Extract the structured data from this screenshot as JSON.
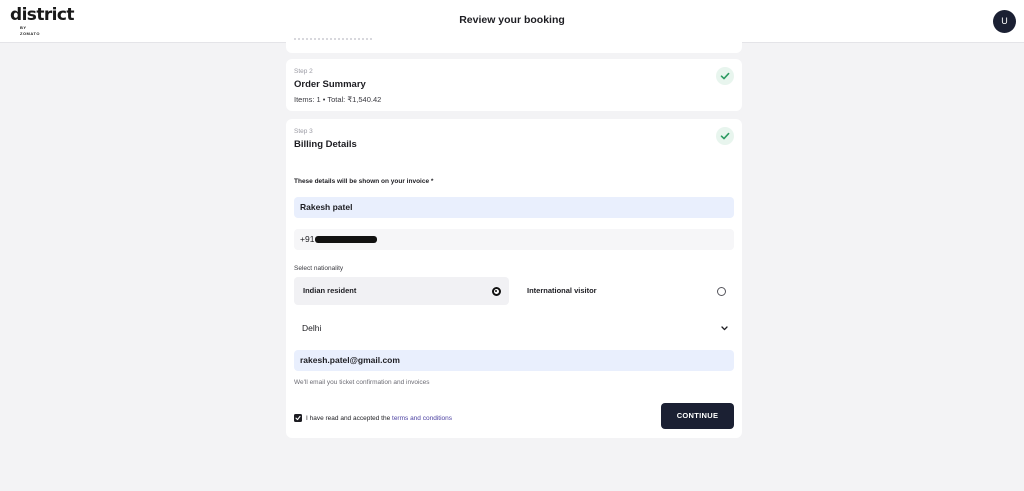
{
  "header": {
    "logo_text": "district",
    "logo_sub": "BY ZOMATO",
    "title": "Review your booking",
    "avatar_initial": "U"
  },
  "steps": [
    {
      "label": "Step 2",
      "title": "Order Summary",
      "meta": "Items: 1 • Total: ₹1,540.42",
      "complete": true
    },
    {
      "label": "Step 3",
      "title": "Billing Details",
      "complete": true
    }
  ],
  "billing": {
    "hint": "These details will be shown on your invoice *",
    "name_value": "Rakesh patel",
    "phone_prefix": "+91",
    "nationality_label": "Select nationality",
    "options": [
      {
        "label": "Indian resident",
        "selected": true
      },
      {
        "label": "International visitor",
        "selected": false
      }
    ],
    "state_value": "Delhi",
    "email_value": "rakesh.patel@gmail.com",
    "email_note": "We'll email you ticket confirmation and invoices",
    "terms_prefix": "I have read and accepted the",
    "terms_link": "terms and conditions",
    "terms_checked": true,
    "continue_label": "CONTINUE"
  },
  "colors": {
    "accent_dark": "#1b2033",
    "check_green": "#2e9b63",
    "field_fill": "#e9effd",
    "link": "#4a3fa0"
  },
  "icons": [
    "check-icon",
    "chevron-down-icon",
    "radio-icon",
    "checkbox-icon"
  ]
}
